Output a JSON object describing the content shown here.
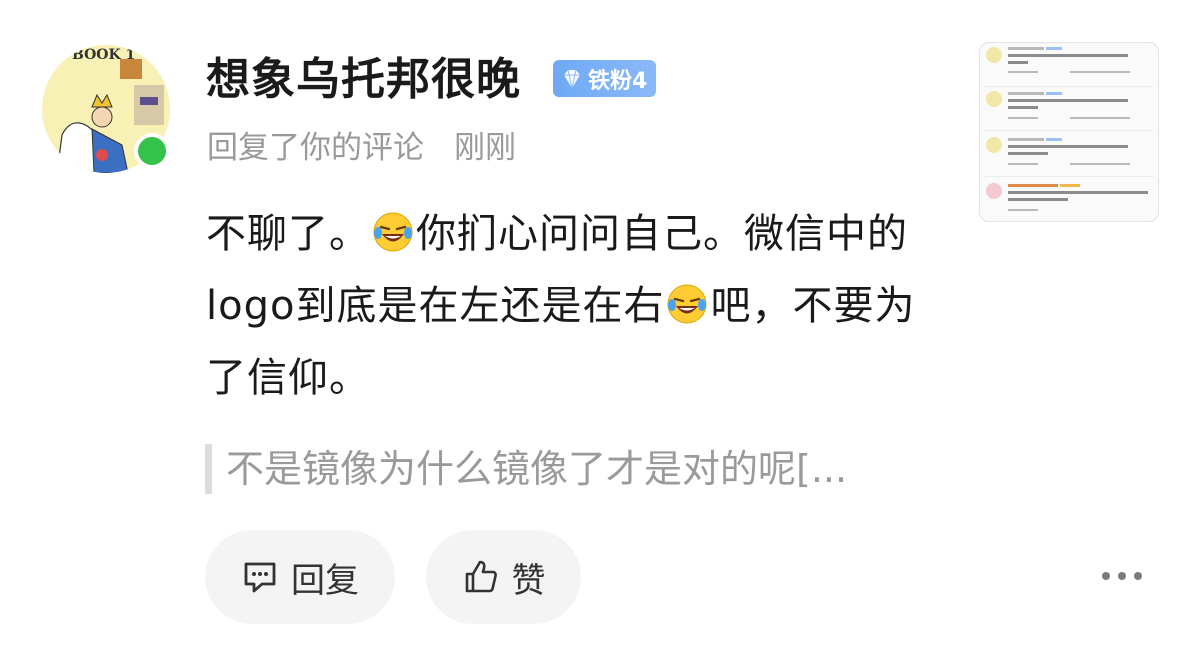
{
  "user": {
    "name": "想象乌托邦很晚",
    "badge_label": "铁粉4",
    "avatar_text": "BOOK 1"
  },
  "meta": {
    "action": "回复了你的评论",
    "time": "刚刚"
  },
  "comment": {
    "part1": "不聊了。",
    "part2": "你扪心问问自己。微信中的logo到底是在左还是在右",
    "part3": "吧，不要为了信仰。"
  },
  "quote": {
    "text": "不是镜像为什么镜像了才是对的呢[..."
  },
  "actions": {
    "reply_label": "回复",
    "like_label": "赞"
  },
  "colors": {
    "online": "#34c24a",
    "badge": "#6ea9f5",
    "muted_text": "#9a9a9a",
    "pill_bg": "#f4f4f4"
  },
  "icons": [
    "comment-icon",
    "thumbs-up-icon",
    "diamond-icon",
    "more-icon",
    "laughing-tears-emoji"
  ]
}
